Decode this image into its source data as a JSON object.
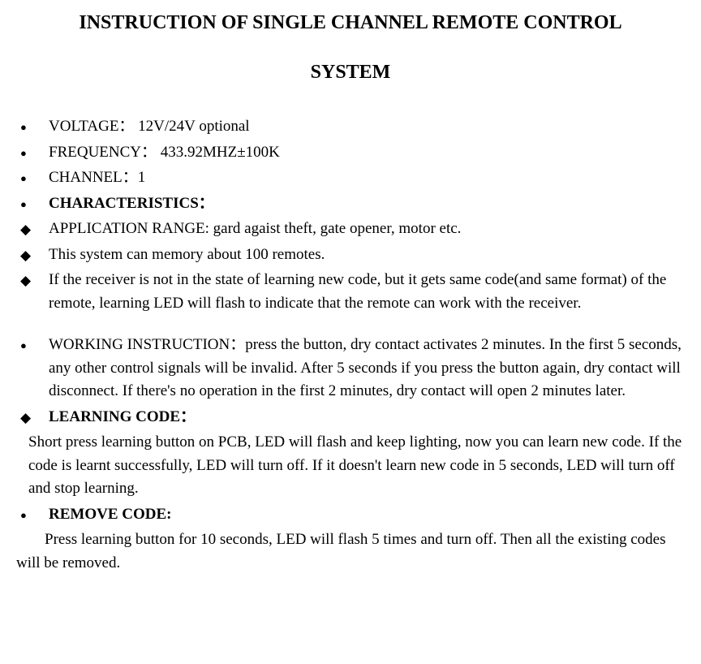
{
  "title": "INSTRUCTION OF SINGLE CHANNEL REMOTE CONTROL",
  "subtitle": "SYSTEM",
  "items": {
    "voltage": "VOLTAGE： 12V/24V optional",
    "frequency": "FREQUENCY： 433.92MHZ±100K",
    "channel": "CHANNEL：1",
    "characteristics": "CHARACTERISTICS：",
    "application": "APPLICATION RANGE: gard agaist theft, gate opener, motor etc.",
    "memory": "This system can memory about 100 remotes.",
    "receiver": "If the receiver is not in the state of learning new code, but it gets same code(and same format) of the remote, learning LED will flash to indicate that the remote can work with the receiver.",
    "working": "WORKING INSTRUCTION：press the button, dry contact activates 2 minutes. In the first 5 seconds, any other control signals will be invalid. After 5 seconds if you press the button again, dry contact will disconnect. If there's no operation in the first 2 minutes, dry contact will open 2 minutes later.",
    "learning_code_label": "LEARNING CODE：",
    "learning_code_text": "Short press learning button on PCB, LED will flash and keep lighting, now you can learn new code. If the code is learnt successfully, LED will turn off. If it doesn't learn new code in 5 seconds, LED will turn off and stop learning.",
    "remove_code_label": " REMOVE CODE:",
    "remove_code_text": "Press learning button for 10 seconds, LED will flash 5 times and turn off. Then all the existing codes will be removed."
  }
}
